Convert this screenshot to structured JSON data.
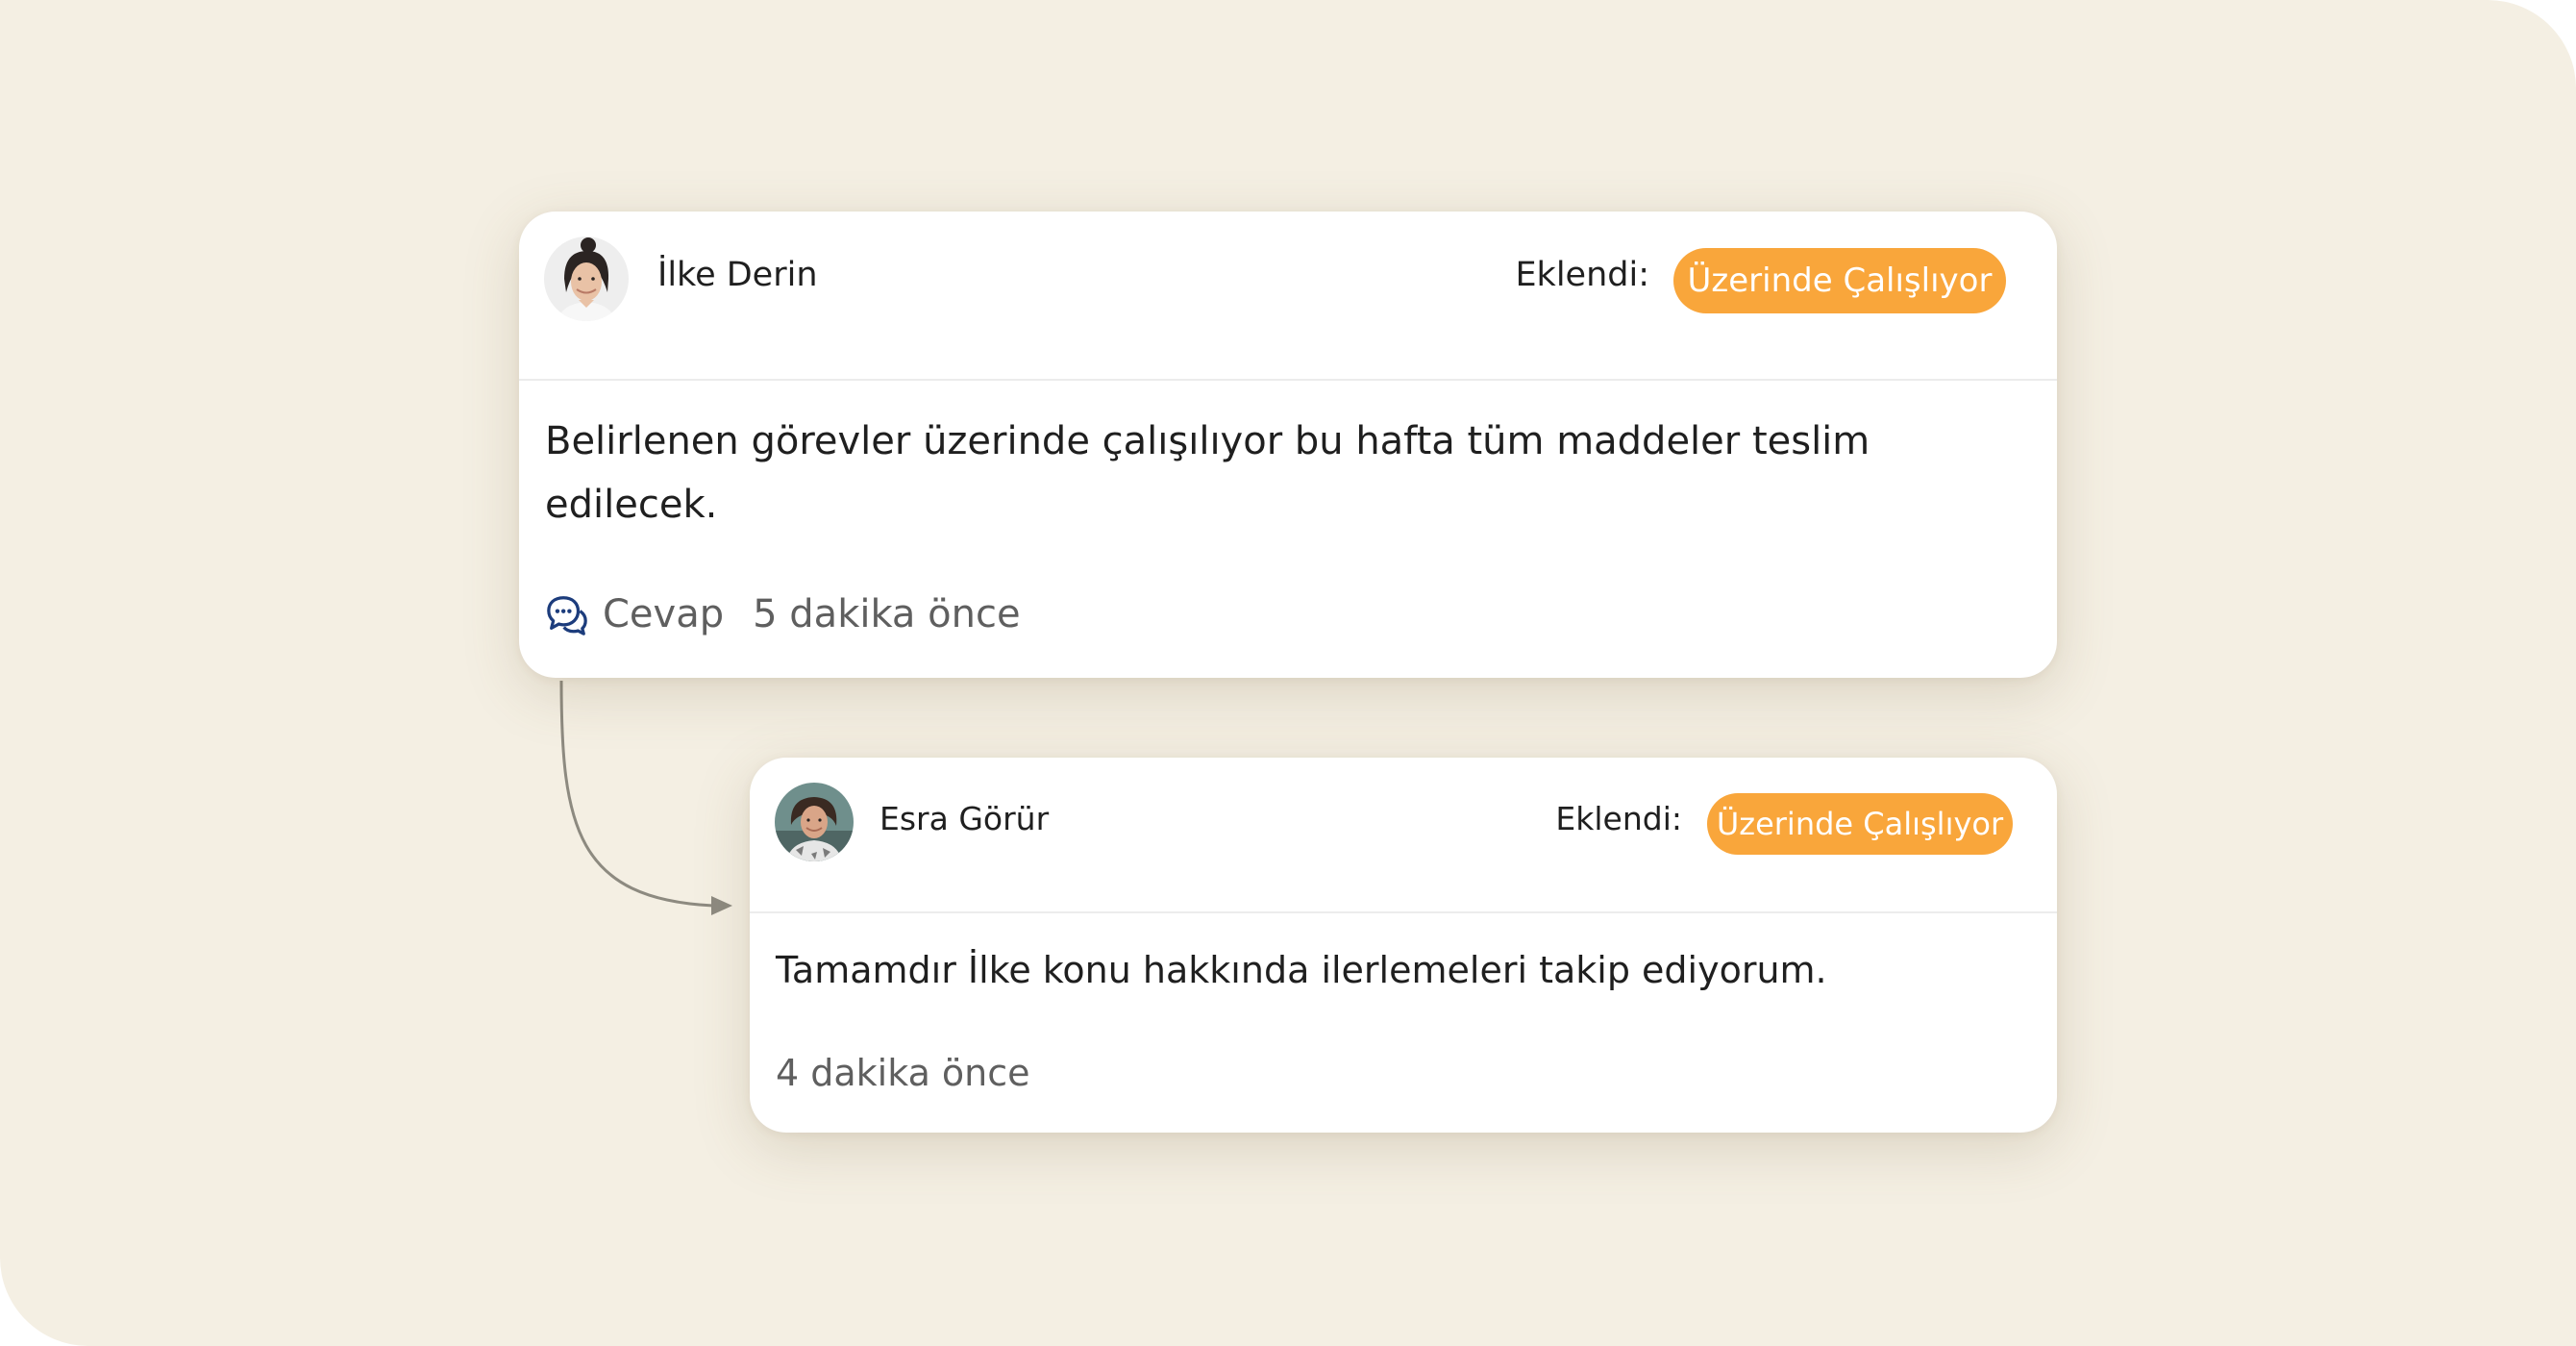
{
  "colors": {
    "background": "#f4efe3",
    "card": "#ffffff",
    "badge": "#f9a63b",
    "reply_icon": "#1c3c7c",
    "connector": "#8d8a80"
  },
  "comments": [
    {
      "author": "İlke Derin",
      "added_label": "Eklendi:",
      "status": "Üzerinde Çalışlıyor",
      "message": "Belirlenen görevler üzerinde çalışılıyor bu hafta tüm maddeler teslim edilecek.",
      "reply_icon": "chat-bubbles-icon",
      "reply_label": "Cevap",
      "time": "5 dakika önce"
    },
    {
      "author": "Esra Görür",
      "added_label": "Eklendi:",
      "status": "Üzerinde Çalışlıyor",
      "message": "Tamamdır İlke konu hakkında ilerlemeleri takip ediyorum.",
      "time": "4 dakika önce"
    }
  ]
}
